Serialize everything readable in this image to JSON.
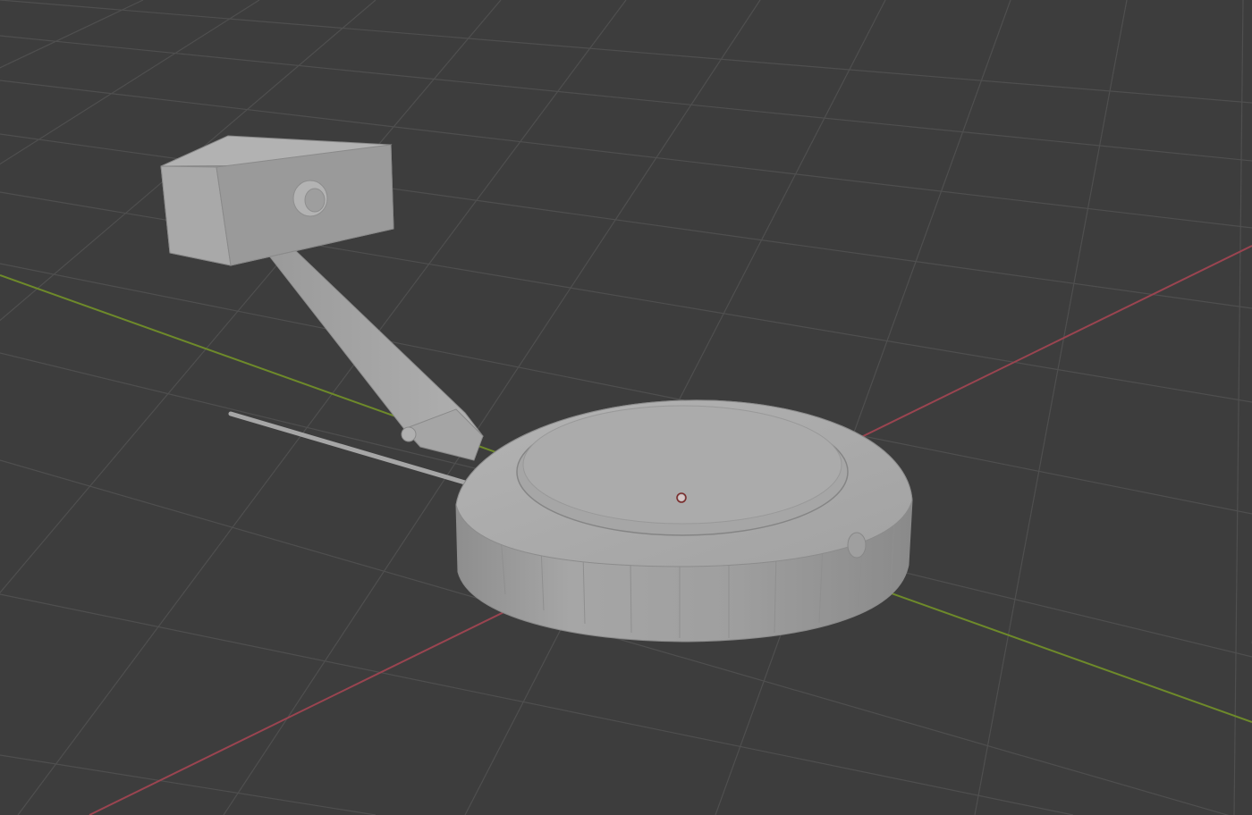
{
  "app": {
    "name": "3d-viewport"
  },
  "viewport": {
    "background_color": "#3d3d3d",
    "grid_color": "#4f4f4f",
    "x_axis_color": "#9a4450",
    "y_axis_color": "#6e8a2a",
    "origin_marker_color": "#7a2a2a"
  },
  "scene": {
    "objects": [
      {
        "name": "robot-vacuum-base",
        "color": "#a7a7a7"
      },
      {
        "name": "support-arm",
        "color": "#a0a0a0"
      },
      {
        "name": "camera-box",
        "color": "#a5a5a5"
      },
      {
        "name": "antenna-rod",
        "color": "#a4a4a4"
      }
    ]
  }
}
